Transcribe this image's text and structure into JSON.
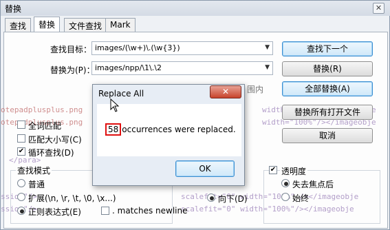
{
  "window": {
    "title": "替换",
    "close_glyph": "✕"
  },
  "tabs": [
    {
      "label": "查找",
      "active": false
    },
    {
      "label": "替换",
      "active": true
    },
    {
      "label": "文件查找",
      "active": false
    },
    {
      "label": "Mark",
      "active": false
    }
  ],
  "form": {
    "find_label": "查找目标：",
    "find_value": "images/(\\w+)\\.(\\w{3})",
    "replace_label": "替换为(P)：",
    "replace_value": "images/npp/\\1\\.\\2",
    "in_selection_label": "围内",
    "dropdown_glyph": "▼"
  },
  "buttons": {
    "find_next": "查找下一个",
    "replace": "替换(R)",
    "replace_all": "全部替换(A)",
    "replace_all_open": "替换所有打开文件",
    "cancel": "取消"
  },
  "options": {
    "whole_word": {
      "label": "全词匹配",
      "checked": false
    },
    "match_case": {
      "label": "匹配大小写(C)",
      "checked": false
    },
    "wrap": {
      "label": "循环查找(D)",
      "checked": true
    }
  },
  "search_mode": {
    "title": "查找模式",
    "normal": "普通",
    "extended": "扩展(\\n, \\r, \\t, \\0, \\x...)",
    "regex": "正则表达式(E)",
    "matches_newline": ". matches newline",
    "selected": "regex"
  },
  "direction": {
    "up_label": "向下(D)",
    "selected": "down"
  },
  "transparency": {
    "label": "透明度",
    "checked": true,
    "on_lose_focus": "失去焦点后",
    "always": "始终"
  },
  "background_text": [
    "otepadplusplus.png",
    "otepadplusplus.png",
    "</para>",
    "ssion\"/>",
    "ssion\"/>",
    "width=\"100%\"/></imageobje",
    "width=\"100%\"/></imageobje",
    "scalefit=\"0\" width=\"100%\" /></imageobje",
    "scalefit=\"0\" width=\"100%\"/></imageobje"
  ],
  "dialog": {
    "title": "Replace All",
    "close_glyph": "✕",
    "count": "58",
    "message": "occurrences were replaced.",
    "ok_label": "OK"
  }
}
